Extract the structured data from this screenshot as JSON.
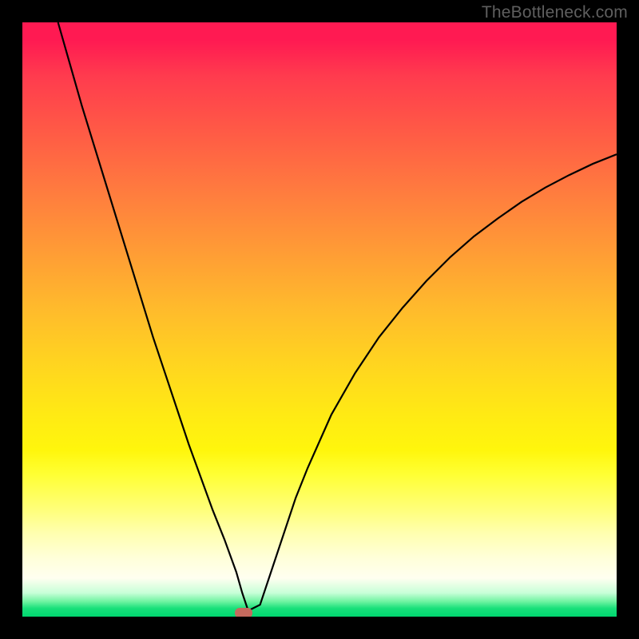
{
  "watermark": "TheBottleneck.com",
  "chart_data": {
    "type": "line",
    "title": "",
    "xlabel": "",
    "ylabel": "",
    "xlim": [
      0,
      100
    ],
    "ylim": [
      0,
      100
    ],
    "grid": false,
    "legend": false,
    "gradient_stops": [
      {
        "pos": 0,
        "color": "#ff1a52"
      },
      {
        "pos": 0.38,
        "color": "#ff9a36"
      },
      {
        "pos": 0.66,
        "color": "#ffea14"
      },
      {
        "pos": 0.9,
        "color": "#ffffd8"
      },
      {
        "pos": 1.0,
        "color": "#00d770"
      }
    ],
    "series": [
      {
        "name": "bottleneck-curve",
        "x": [
          6,
          8,
          10,
          12,
          14,
          16,
          18,
          20,
          22,
          24,
          26,
          28,
          30,
          32,
          34,
          36,
          37,
          38,
          40,
          42,
          44,
          46,
          48,
          52,
          56,
          60,
          64,
          68,
          72,
          76,
          80,
          84,
          88,
          92,
          96,
          100
        ],
        "y": [
          100,
          93,
          86,
          79.5,
          73,
          66.5,
          60,
          53.5,
          47,
          41,
          35,
          29,
          23.5,
          18,
          13,
          7.5,
          4,
          1,
          2,
          8,
          14,
          20,
          25,
          34,
          41,
          47,
          52,
          56.5,
          60.5,
          64,
          67,
          69.8,
          72.2,
          74.3,
          76.2,
          77.8
        ]
      }
    ],
    "marker": {
      "x": 37.2,
      "y": 0.5,
      "color": "#c46a5e"
    }
  }
}
